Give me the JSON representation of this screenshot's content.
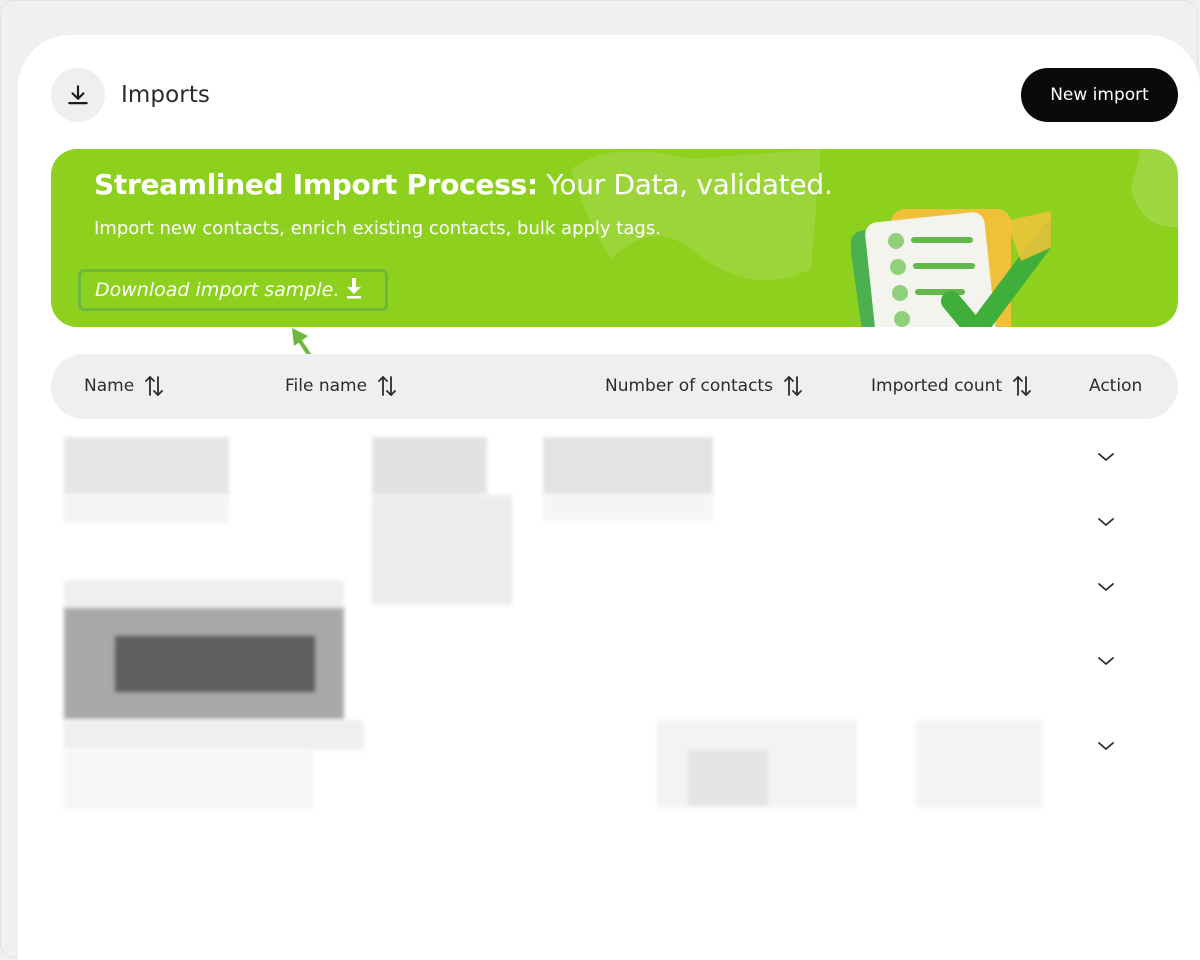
{
  "header": {
    "title": "Imports",
    "new_import_label": "New import"
  },
  "banner": {
    "title_bold": "Streamlined Import Process:",
    "title_rest": " Your Data, validated.",
    "subtitle": "Import new contacts, enrich existing contacts, bulk apply tags.",
    "download_label": "Download import sample.",
    "color": "#8ed01e"
  },
  "table": {
    "columns": [
      "Name",
      "File name",
      "Number of contacts",
      "Imported count",
      "Action"
    ],
    "row_count_visible": 5
  },
  "colors": {
    "accent": "#8ed01e",
    "button_dark": "#0a0a0a",
    "annotation_arrow": "#6db83a"
  }
}
